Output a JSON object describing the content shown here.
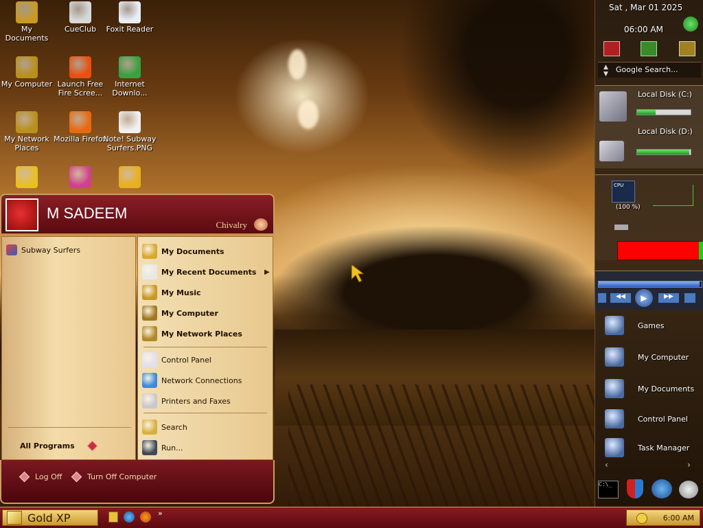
{
  "desktop": {
    "icons": [
      {
        "label": "My Documents",
        "icon": "folder-documents-icon",
        "color": "#c89a20"
      },
      {
        "label": "CueClub",
        "icon": "cueclub-icon",
        "color": "#d8d8d8"
      },
      {
        "label": "Foxit Reader",
        "icon": "foxit-reader-icon",
        "color": "#e8eef8"
      },
      {
        "label": "My Computer",
        "icon": "computer-icon",
        "color": "#b8901c"
      },
      {
        "label": "Launch Free Fire Scree...",
        "icon": "free-fire-icon",
        "color": "#e85010"
      },
      {
        "label": "Internet Downlo...",
        "icon": "internet-download-manager-icon",
        "color": "#3aa040"
      },
      {
        "label": "My Network Places",
        "icon": "network-places-icon",
        "color": "#b8901c"
      },
      {
        "label": "Mozilla Firefox",
        "icon": "firefox-icon",
        "color": "#e86a10"
      },
      {
        "label": "Note! Subway Surfers.PNG",
        "icon": "png-file-icon",
        "color": "#f0f0f0"
      },
      {
        "label": "",
        "icon": "recycle-bin-icon",
        "color": "#e8c020"
      },
      {
        "label": "",
        "icon": "app-icon",
        "color": "#d04090"
      },
      {
        "label": "",
        "icon": "sun-gear-icon",
        "color": "#e8b020"
      }
    ]
  },
  "start_menu": {
    "username": "M SADEEM",
    "theme_label": "Chivalry",
    "pinned": [
      {
        "label": "Subway Surfers",
        "icon": "subway-surfers-icon"
      }
    ],
    "all_programs": "All Programs",
    "places": [
      {
        "label": "My Documents",
        "icon": "folder-documents-icon",
        "bold": true
      },
      {
        "label": "My Recent Documents",
        "icon": "recent-documents-icon",
        "bold": true,
        "submenu": true
      },
      {
        "label": "My Music",
        "icon": "music-folder-icon",
        "bold": true
      },
      {
        "label": "My Computer",
        "icon": "computer-icon",
        "bold": true
      },
      {
        "label": "My Network Places",
        "icon": "network-places-icon",
        "bold": true
      }
    ],
    "settings": [
      {
        "label": "Control Panel",
        "icon": "control-panel-icon"
      },
      {
        "label": "Network Connections",
        "icon": "network-connections-icon"
      },
      {
        "label": "Printers and Faxes",
        "icon": "printer-icon"
      }
    ],
    "tools": [
      {
        "label": "Search",
        "icon": "search-icon"
      },
      {
        "label": "Run...",
        "icon": "run-icon"
      }
    ],
    "log_off": "Log Off",
    "turn_off": "Turn Off Computer"
  },
  "sidebar": {
    "date": "Sat , Mar 01 2025",
    "time": "06:00 AM",
    "search_placeholder": "Google Search...",
    "disks": [
      {
        "label": "Local Disk (C:)",
        "used_fraction": 0.35
      },
      {
        "label": "Local Disk (D:)",
        "used_fraction": 0.97
      }
    ],
    "cpu_label": "CPU",
    "cpu_percent": "(100 %)",
    "media_progress_fraction": 0.98,
    "shortcuts": [
      {
        "label": "Games",
        "icon": "games-folder-icon"
      },
      {
        "label": "My Computer",
        "icon": "computer-icon"
      },
      {
        "label": "My Documents",
        "icon": "folder-documents-icon"
      },
      {
        "label": "Control Panel",
        "icon": "control-panel-icon"
      },
      {
        "label": "Task Manager",
        "icon": "task-manager-icon"
      }
    ]
  },
  "taskbar": {
    "start_label": "Gold XP",
    "clock": "6:00 AM",
    "chevron": "»"
  },
  "colors": {
    "accent_maroon": "#7a1820",
    "accent_gold": "#d8b070",
    "bar_green": "#1a9a1a",
    "bar_red": "#ff0000"
  }
}
